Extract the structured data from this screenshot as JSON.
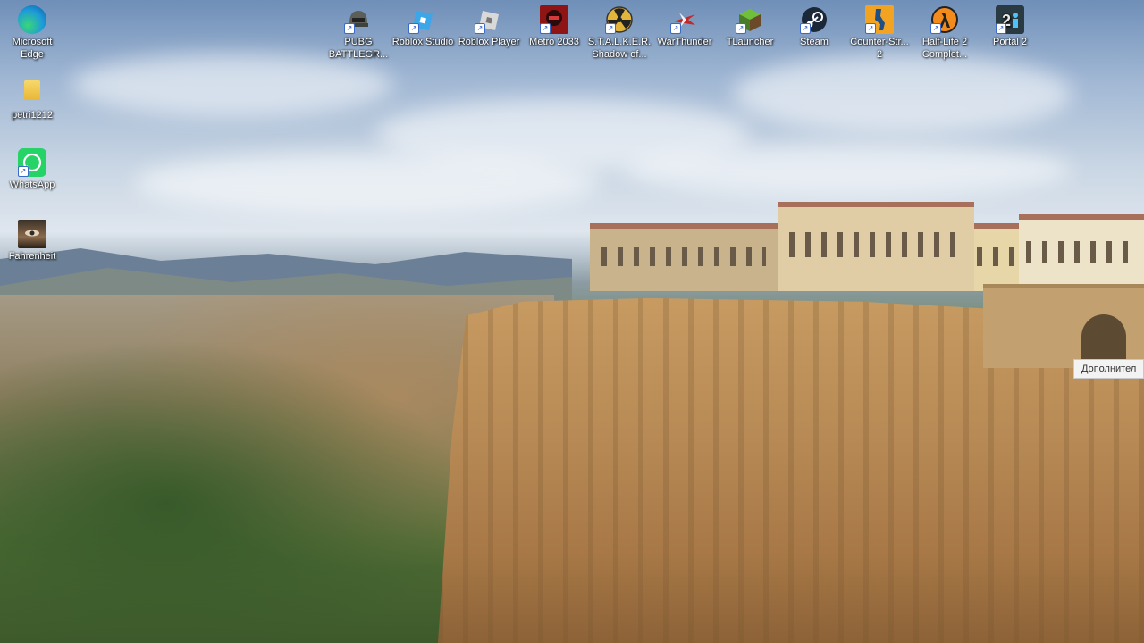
{
  "desktop": {
    "icons": [
      {
        "label": "Microsoft Edge",
        "icon": "edge-icon",
        "shortcut": false
      },
      {
        "label": "petri1212",
        "icon": "folder-icon",
        "shortcut": false
      },
      {
        "label": "WhatsApp",
        "icon": "whatsapp-icon",
        "shortcut": true
      },
      {
        "label": "Fahrenheit",
        "icon": "fahrenheit-icon",
        "shortcut": false
      },
      {
        "label": "PUBG BATTLEGR...",
        "icon": "pubg-icon",
        "shortcut": true
      },
      {
        "label": "Roblox Studio",
        "icon": "roblox-studio-icon",
        "shortcut": true
      },
      {
        "label": "Roblox Player",
        "icon": "roblox-player-icon",
        "shortcut": true
      },
      {
        "label": "Metro 2033",
        "icon": "metro-2033-icon",
        "shortcut": true
      },
      {
        "label": "S.T.A.L.K.E.R. Shadow of...",
        "icon": "stalker-icon",
        "shortcut": true
      },
      {
        "label": "WarThunder",
        "icon": "warthunder-icon",
        "shortcut": true
      },
      {
        "label": "TLauncher",
        "icon": "tlauncher-icon",
        "shortcut": true
      },
      {
        "label": "Steam",
        "icon": "steam-icon",
        "shortcut": true
      },
      {
        "label": "Counter-Str... 2",
        "icon": "counter-strike-icon",
        "shortcut": true
      },
      {
        "label": "Half-Life 2 Complet...",
        "icon": "half-life-icon",
        "shortcut": true
      },
      {
        "label": "Portal 2",
        "icon": "portal-icon",
        "shortcut": true
      }
    ]
  },
  "tooltip": {
    "text": "Дополнител"
  },
  "colors": {
    "edge": "#1d9bd8",
    "folder": "#f0c54a",
    "whatsapp": "#25d366",
    "steam": "#1b2838",
    "metro": "#b01d1d",
    "stalker": "#e2b43a",
    "tlauncher": "#5a9a3a"
  }
}
